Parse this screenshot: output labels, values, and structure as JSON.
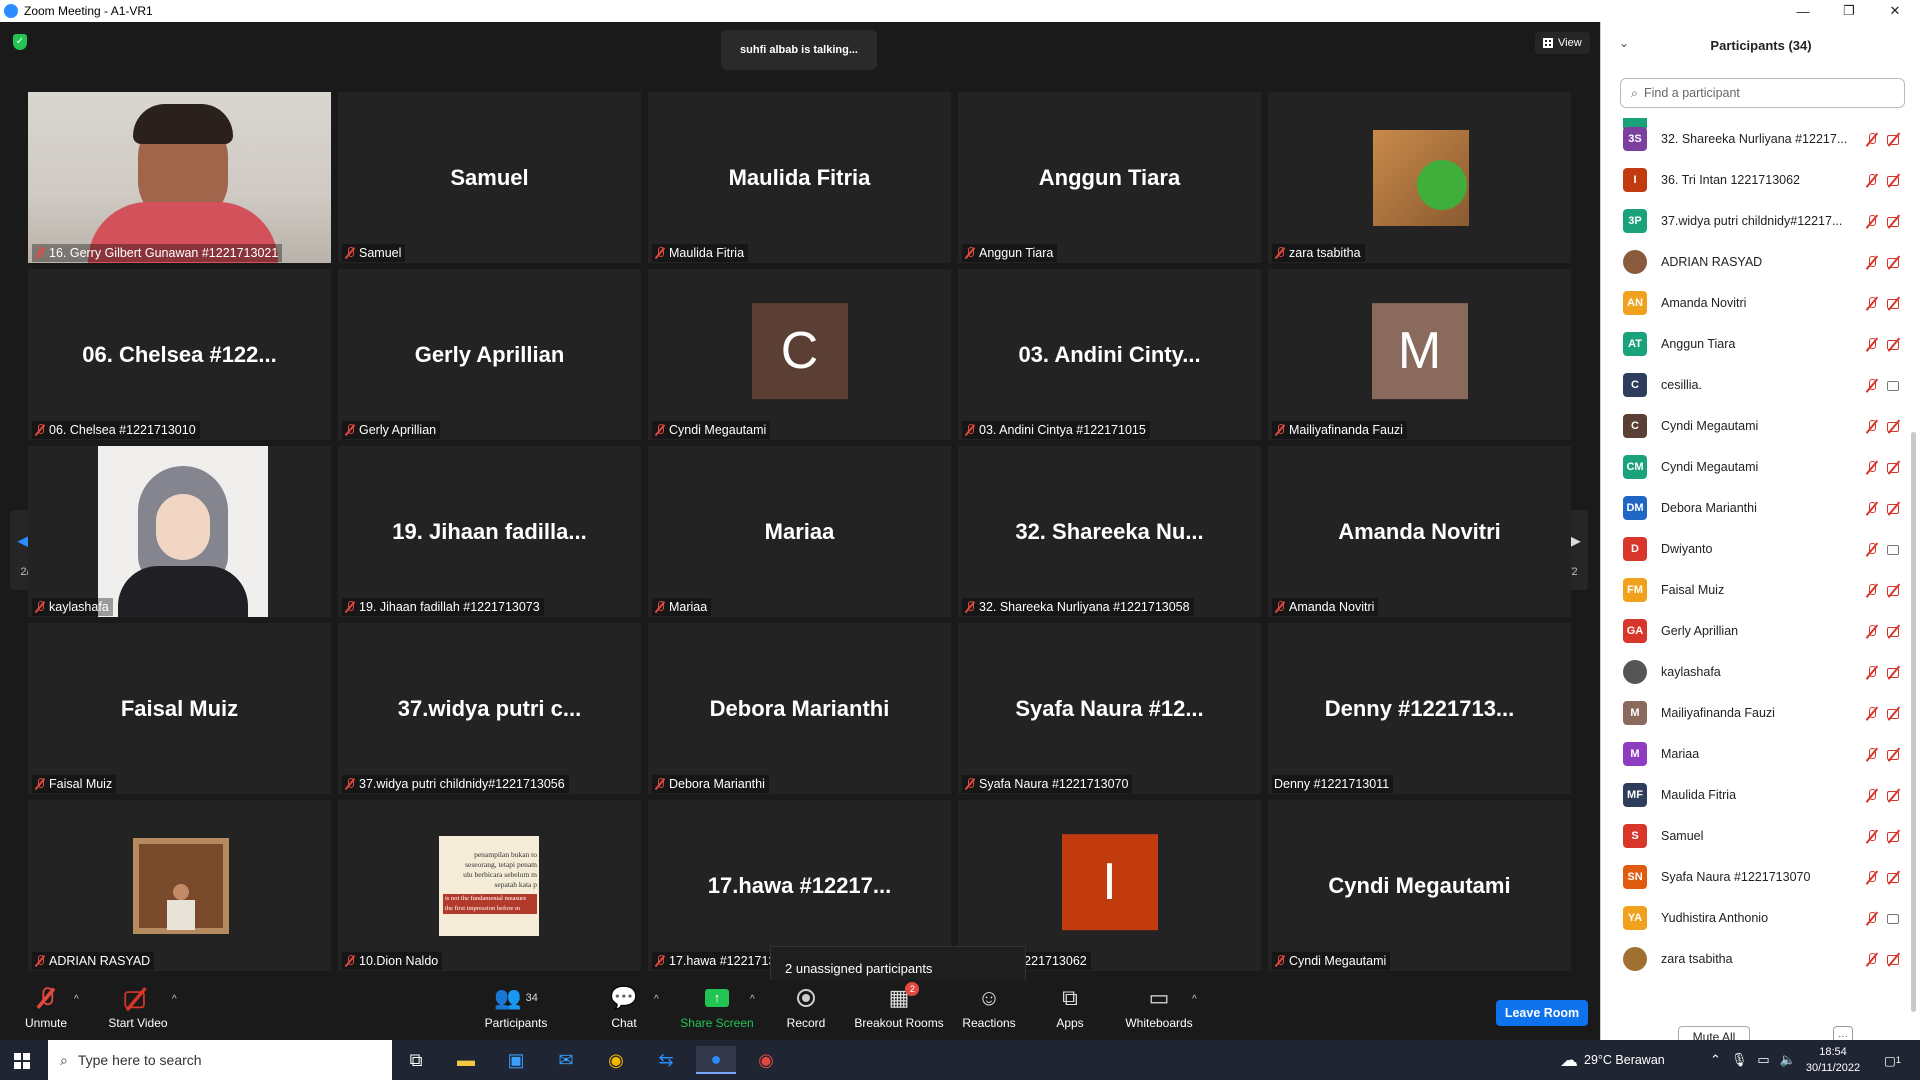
{
  "window": {
    "title": "Zoom Meeting - A1-VR1"
  },
  "meeting": {
    "talking": "suhfi albab is talking...",
    "view_label": "View",
    "page_left": "2/2",
    "page_right": "2/2",
    "unassigned_tooltip": "2 unassigned participants",
    "tiles": [
      {
        "big": "",
        "label": "16. Gerry Gilbert Gunawan #1221713021",
        "kind": "video-man"
      },
      {
        "big": "Samuel",
        "label": "Samuel",
        "kind": "name"
      },
      {
        "big": "Maulida Fitria",
        "label": "Maulida Fitria",
        "kind": "name"
      },
      {
        "big": "Anggun Tiara",
        "label": "Anggun Tiara",
        "kind": "name"
      },
      {
        "big": "",
        "label": "zara tsabitha",
        "kind": "pic-cat"
      },
      {
        "big": "06. Chelsea #122...",
        "label": "06. Chelsea #1221713010",
        "kind": "name"
      },
      {
        "big": "Gerly Aprillian",
        "label": "Gerly Aprillian",
        "kind": "name"
      },
      {
        "big": "C",
        "label": "Cyndi Megautami",
        "kind": "avatar",
        "color": "#5b3e34"
      },
      {
        "big": "03. Andini Cinty...",
        "label": "03. Andini Cintya #122171015",
        "kind": "name"
      },
      {
        "big": "M",
        "label": "Mailiyafinanda Fauzi",
        "kind": "avatar",
        "color": "#8b6a5e"
      },
      {
        "big": "",
        "label": "kaylashafa",
        "kind": "video-girl"
      },
      {
        "big": "19. Jihaan fadilla...",
        "label": "19. Jihaan fadillah #1221713073",
        "kind": "name"
      },
      {
        "big": "Mariaa",
        "label": "Mariaa",
        "kind": "name"
      },
      {
        "big": "32. Shareeka Nu...",
        "label": "32. Shareeka Nurliyana #1221713058",
        "kind": "name"
      },
      {
        "big": "Amanda Novitri",
        "label": "Amanda Novitri",
        "kind": "name"
      },
      {
        "big": "Faisal Muiz",
        "label": "Faisal Muiz",
        "kind": "name"
      },
      {
        "big": "37.widya putri c...",
        "label": "37.widya putri childnidy#1221713056",
        "kind": "name"
      },
      {
        "big": "Debora Marianthi",
        "label": "Debora Marianthi",
        "kind": "name"
      },
      {
        "big": "Syafa Naura #12...",
        "label": "Syafa Naura #1221713070",
        "kind": "name"
      },
      {
        "big": "Denny #1221713...",
        "label": "Denny #1221713011",
        "kind": "name-nomute"
      },
      {
        "big": "",
        "label": "ADRIAN RASYAD",
        "kind": "pic-adrian"
      },
      {
        "big": "",
        "label": "10.Dion Naldo",
        "kind": "pic-quote"
      },
      {
        "big": "17.hawa #12217...",
        "label": "17.hawa #1221713...",
        "kind": "name"
      },
      {
        "big": "I",
        "label": "...ntan 1221713062",
        "kind": "avatar",
        "color": "#c23b0f"
      },
      {
        "big": "Cyndi Megautami",
        "label": "Cyndi Megautami",
        "kind": "name"
      }
    ],
    "quote_lines": [
      "penampilan bukan to",
      "seseorang, tetapi penam",
      "ulu berbicara sebelum m",
      "sepatah kata p",
      "is not the fundamental measure",
      "the first impression before m"
    ]
  },
  "toolbar": {
    "unmute": "Unmute",
    "start_video": "Start Video",
    "participants": "Participants",
    "participants_count": "34",
    "chat": "Chat",
    "share_screen": "Share Screen",
    "record": "Record",
    "breakout": "Breakout Rooms",
    "breakout_badge": "2",
    "reactions": "Reactions",
    "apps": "Apps",
    "whiteboards": "Whiteboards",
    "leave": "Leave Room"
  },
  "panel": {
    "title": "Participants (34)",
    "search_placeholder": "Find a participant",
    "mute_all": "Mute All",
    "more": "···",
    "participants": [
      {
        "initials": "3S",
        "name": "32. Shareeka Nurliyana #12217...",
        "color": "#7b3fa0",
        "cam": "off"
      },
      {
        "initials": "I",
        "name": "36. Tri Intan 1221713062",
        "color": "#c23b0f",
        "cam": "off"
      },
      {
        "initials": "3P",
        "name": "37.widya putri childnidy#12217...",
        "color": "#1aa37a",
        "cam": "off"
      },
      {
        "initials": "",
        "name": "ADRIAN RASYAD",
        "color": "#8a5a3c",
        "cam": "off"
      },
      {
        "initials": "AN",
        "name": "Amanda Novitri",
        "color": "#f0a21e",
        "cam": "off"
      },
      {
        "initials": "AT",
        "name": "Anggun Tiara",
        "color": "#1aa37a",
        "cam": "off"
      },
      {
        "initials": "C",
        "name": "cesillia.",
        "color": "#2e3d5c",
        "cam": "on"
      },
      {
        "initials": "C",
        "name": "Cyndi Megautami",
        "color": "#5b3e34",
        "cam": "off"
      },
      {
        "initials": "CM",
        "name": "Cyndi Megautami",
        "color": "#1aa37a",
        "cam": "off"
      },
      {
        "initials": "DM",
        "name": "Debora Marianthi",
        "color": "#2066c4",
        "cam": "off"
      },
      {
        "initials": "D",
        "name": "Dwiyanto",
        "color": "#d9362b",
        "cam": "on"
      },
      {
        "initials": "FM",
        "name": "Faisal Muiz",
        "color": "#f0a21e",
        "cam": "off"
      },
      {
        "initials": "GA",
        "name": "Gerly Aprillian",
        "color": "#d9362b",
        "cam": "off"
      },
      {
        "initials": "",
        "name": "kaylashafa",
        "color": "#555555",
        "cam": "off"
      },
      {
        "initials": "M",
        "name": "Mailiyafinanda Fauzi",
        "color": "#8b6a5e",
        "cam": "off"
      },
      {
        "initials": "M",
        "name": "Mariaa",
        "color": "#8e3cc0",
        "cam": "off"
      },
      {
        "initials": "MF",
        "name": "Maulida Fitria",
        "color": "#2e3d5c",
        "cam": "off"
      },
      {
        "initials": "S",
        "name": "Samuel",
        "color": "#d9362b",
        "cam": "off"
      },
      {
        "initials": "SN",
        "name": "Syafa Naura #1221713070",
        "color": "#e05a0f",
        "cam": "off"
      },
      {
        "initials": "YA",
        "name": "Yudhistira Anthonio",
        "color": "#f0a21e",
        "cam": "on"
      },
      {
        "initials": "",
        "name": "zara tsabitha",
        "color": "#a07030",
        "cam": "off"
      }
    ]
  },
  "taskbar": {
    "search_placeholder": "Type here to search",
    "weather": "29°C  Berawan",
    "time": "18:54",
    "date": "30/11/2022",
    "notification_count": "1"
  }
}
